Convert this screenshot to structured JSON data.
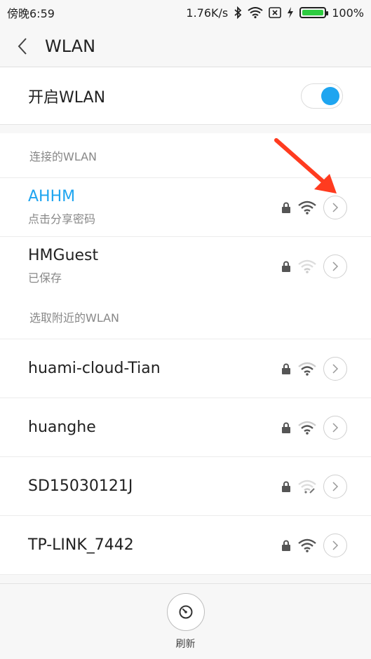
{
  "status_bar": {
    "time": "傍晚6:59",
    "speed": "1.76K/s",
    "battery_text": "100%",
    "battery_level": 1.0
  },
  "title_bar": {
    "title": "WLAN"
  },
  "wlan_toggle": {
    "label": "开启WLAN",
    "enabled": true,
    "accent": "#1ea5f0"
  },
  "connected_section": {
    "header": "连接的WLAN",
    "networks": [
      {
        "name": "AHHM",
        "sub": "点击分享密码",
        "connected": true,
        "signal": "strong"
      },
      {
        "name": "HMGuest",
        "sub": "已保存",
        "connected": false,
        "signal": "weak"
      }
    ]
  },
  "nearby_section": {
    "header": "选取附近的WLAN",
    "networks": [
      {
        "name": "huami-cloud-Tian",
        "signal": "medium"
      },
      {
        "name": "huanghe",
        "signal": "medium"
      },
      {
        "name": "SD15030121J",
        "signal": "weak-linked"
      },
      {
        "name": "TP-LINK_7442",
        "signal": "strong"
      }
    ]
  },
  "bottom_bar": {
    "refresh_label": "刷新"
  },
  "colors": {
    "accent": "#1ea5f0",
    "annotation_arrow": "#ff3b1f"
  },
  "icons": [
    "back-icon",
    "bluetooth-icon",
    "wifi-icon",
    "close-box-icon",
    "charging-icon",
    "lock-icon",
    "chevron-right-icon",
    "refresh-icon"
  ]
}
